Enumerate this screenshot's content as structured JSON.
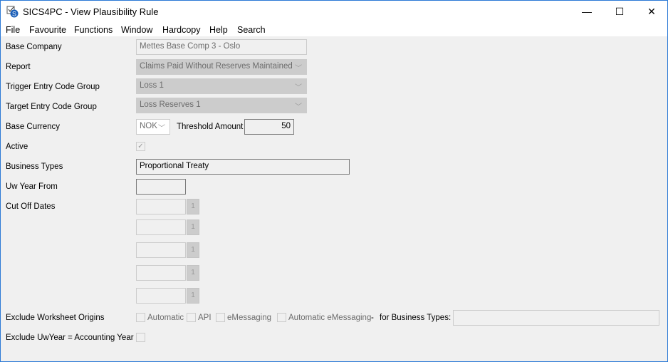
{
  "window": {
    "title": "SICS4PC - View Plausibility Rule",
    "minimize": "—",
    "maximize": "☐",
    "close": "✕"
  },
  "menu": [
    "File",
    "Favourite",
    "Functions",
    "Window",
    "Hardcopy",
    "Help",
    "Search"
  ],
  "form": {
    "base_company": {
      "label": "Base Company",
      "value": "Mettes Base Comp 3 - Oslo"
    },
    "report": {
      "label": "Report",
      "value": "Claims Paid Without Reserves Maintained"
    },
    "trigger": {
      "label": "Trigger Entry Code Group",
      "value": "Loss 1"
    },
    "target": {
      "label": "Target Entry Code Group",
      "value": "Loss Reserves 1"
    },
    "currency": {
      "label": "Base Currency",
      "value": "NOK"
    },
    "threshold": {
      "label": "Threshold Amount",
      "value": "50"
    },
    "active": {
      "label": "Active",
      "checked": true
    },
    "business_types": {
      "label": "Business Types",
      "value": "Proportional Treaty"
    },
    "uw_year_from": {
      "label": "Uw Year From",
      "value": ""
    },
    "cut_off_dates": {
      "label": "Cut Off Dates",
      "calendar_glyph": "1"
    },
    "exclude_origins": {
      "label": "Exclude Worksheet Origins",
      "options": [
        "Automatic",
        "API",
        "eMessaging",
        "Automatic eMessaging"
      ],
      "dash": "-",
      "for_bt_label": "for Business Types:",
      "for_bt_value": ""
    },
    "exclude_uwyear": {
      "label": "Exclude UwYear = Accounting Year"
    }
  }
}
